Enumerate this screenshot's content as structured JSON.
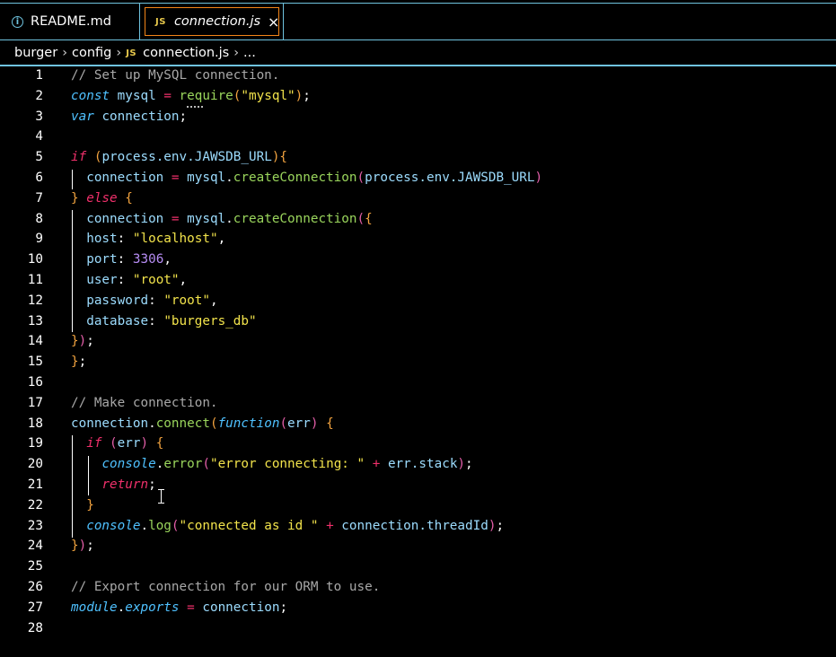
{
  "tabs": [
    {
      "label": "README.md",
      "icon": "info-icon",
      "active": false
    },
    {
      "label": "connection.js",
      "icon": "js-icon",
      "active": true,
      "close": "×"
    }
  ],
  "js_icon_text": "JS",
  "info_icon_text": "i",
  "breadcrumb": {
    "items": [
      "burger",
      "config",
      "connection.js",
      "..."
    ],
    "separator": "›"
  },
  "colors": {
    "accent_border": "#6fc3df",
    "active_tab_border": "#f38518",
    "background": "#000000"
  },
  "lines": [
    {
      "n": "1",
      "tokens": [
        [
          "c-com",
          "// Set up MySQL connection."
        ]
      ]
    },
    {
      "n": "2",
      "tokens": [
        [
          "c-kw",
          "const"
        ],
        [
          "c-pun",
          " "
        ],
        [
          "c-var",
          "mysql"
        ],
        [
          "c-pun",
          " "
        ],
        [
          "c-op",
          "="
        ],
        [
          "c-pun",
          " "
        ],
        [
          "c-fn",
          "require"
        ],
        [
          "c-p1",
          "("
        ],
        [
          "c-str",
          "\"mysql\""
        ],
        [
          "c-p1",
          ")"
        ],
        [
          "c-pun",
          ";"
        ]
      ]
    },
    {
      "n": "3",
      "tokens": [
        [
          "c-kw",
          "var"
        ],
        [
          "c-pun",
          " "
        ],
        [
          "c-var",
          "connection"
        ],
        [
          "c-pun",
          ";"
        ]
      ]
    },
    {
      "n": "4",
      "tokens": []
    },
    {
      "n": "5",
      "tokens": [
        [
          "c-ctl",
          "if"
        ],
        [
          "c-pun",
          " "
        ],
        [
          "c-p1",
          "("
        ],
        [
          "c-var",
          "process.env.JAWSDB_URL"
        ],
        [
          "c-p1",
          ")"
        ],
        [
          "c-p1",
          "{"
        ]
      ]
    },
    {
      "n": "6",
      "tokens": [
        [
          "c-pun",
          "  "
        ],
        [
          "c-var",
          "connection"
        ],
        [
          "c-pun",
          " "
        ],
        [
          "c-op",
          "="
        ],
        [
          "c-pun",
          " "
        ],
        [
          "c-var",
          "mysql"
        ],
        [
          "c-pun",
          "."
        ],
        [
          "c-fn",
          "createConnection"
        ],
        [
          "c-p2",
          "("
        ],
        [
          "c-var",
          "process.env.JAWSDB_URL"
        ],
        [
          "c-p2",
          ")"
        ]
      ]
    },
    {
      "n": "7",
      "tokens": [
        [
          "c-p1",
          "}"
        ],
        [
          "c-pun",
          " "
        ],
        [
          "c-ctl",
          "else"
        ],
        [
          "c-pun",
          " "
        ],
        [
          "c-p1",
          "{"
        ]
      ]
    },
    {
      "n": "8",
      "tokens": [
        [
          "c-pun",
          "  "
        ],
        [
          "c-var",
          "connection"
        ],
        [
          "c-pun",
          " "
        ],
        [
          "c-op",
          "="
        ],
        [
          "c-pun",
          " "
        ],
        [
          "c-var",
          "mysql"
        ],
        [
          "c-pun",
          "."
        ],
        [
          "c-fn",
          "createConnection"
        ],
        [
          "c-p2",
          "("
        ],
        [
          "c-p1",
          "{"
        ]
      ]
    },
    {
      "n": "9",
      "tokens": [
        [
          "c-pun",
          "  "
        ],
        [
          "c-var",
          "host"
        ],
        [
          "c-pun",
          ": "
        ],
        [
          "c-str",
          "\"localhost\""
        ],
        [
          "c-pun",
          ","
        ]
      ]
    },
    {
      "n": "10",
      "tokens": [
        [
          "c-pun",
          "  "
        ],
        [
          "c-var",
          "port"
        ],
        [
          "c-pun",
          ": "
        ],
        [
          "c-num",
          "3306"
        ],
        [
          "c-pun",
          ","
        ]
      ]
    },
    {
      "n": "11",
      "tokens": [
        [
          "c-pun",
          "  "
        ],
        [
          "c-var",
          "user"
        ],
        [
          "c-pun",
          ": "
        ],
        [
          "c-str",
          "\"root\""
        ],
        [
          "c-pun",
          ","
        ]
      ]
    },
    {
      "n": "12",
      "tokens": [
        [
          "c-pun",
          "  "
        ],
        [
          "c-var",
          "password"
        ],
        [
          "c-pun",
          ": "
        ],
        [
          "c-str",
          "\"root\""
        ],
        [
          "c-pun",
          ","
        ]
      ]
    },
    {
      "n": "13",
      "tokens": [
        [
          "c-pun",
          "  "
        ],
        [
          "c-var",
          "database"
        ],
        [
          "c-pun",
          ": "
        ],
        [
          "c-str",
          "\"burgers_db\""
        ]
      ]
    },
    {
      "n": "14",
      "tokens": [
        [
          "c-p1",
          "}"
        ],
        [
          "c-p2",
          ")"
        ],
        [
          "c-pun",
          ";"
        ]
      ]
    },
    {
      "n": "15",
      "tokens": [
        [
          "c-p1",
          "}"
        ],
        [
          "c-pun",
          ";"
        ]
      ]
    },
    {
      "n": "16",
      "tokens": []
    },
    {
      "n": "17",
      "tokens": [
        [
          "c-com",
          "// Make connection."
        ]
      ]
    },
    {
      "n": "18",
      "tokens": [
        [
          "c-var",
          "connection"
        ],
        [
          "c-pun",
          "."
        ],
        [
          "c-fn",
          "connect"
        ],
        [
          "c-p1",
          "("
        ],
        [
          "c-kw",
          "function"
        ],
        [
          "c-p2",
          "("
        ],
        [
          "c-var",
          "err"
        ],
        [
          "c-p2",
          ")"
        ],
        [
          "c-pun",
          " "
        ],
        [
          "c-p1",
          "{"
        ]
      ]
    },
    {
      "n": "19",
      "tokens": [
        [
          "c-pun",
          "  "
        ],
        [
          "c-ctl",
          "if"
        ],
        [
          "c-pun",
          " "
        ],
        [
          "c-p2",
          "("
        ],
        [
          "c-var",
          "err"
        ],
        [
          "c-p2",
          ")"
        ],
        [
          "c-pun",
          " "
        ],
        [
          "c-p1",
          "{"
        ]
      ]
    },
    {
      "n": "20",
      "tokens": [
        [
          "c-pun",
          "    "
        ],
        [
          "c-obj",
          "console"
        ],
        [
          "c-pun",
          "."
        ],
        [
          "c-fn",
          "error"
        ],
        [
          "c-p2",
          "("
        ],
        [
          "c-str",
          "\"error connecting: \""
        ],
        [
          "c-pun",
          " "
        ],
        [
          "c-op",
          "+"
        ],
        [
          "c-pun",
          " "
        ],
        [
          "c-var",
          "err.stack"
        ],
        [
          "c-p2",
          ")"
        ],
        [
          "c-pun",
          ";"
        ]
      ]
    },
    {
      "n": "21",
      "tokens": [
        [
          "c-pun",
          "    "
        ],
        [
          "c-ctl",
          "return"
        ],
        [
          "c-pun",
          ";"
        ]
      ]
    },
    {
      "n": "22",
      "tokens": [
        [
          "c-pun",
          "  "
        ],
        [
          "c-p1",
          "}"
        ]
      ]
    },
    {
      "n": "23",
      "tokens": [
        [
          "c-pun",
          "  "
        ],
        [
          "c-obj",
          "console"
        ],
        [
          "c-pun",
          "."
        ],
        [
          "c-fn",
          "log"
        ],
        [
          "c-p2",
          "("
        ],
        [
          "c-str",
          "\"connected as id \""
        ],
        [
          "c-pun",
          " "
        ],
        [
          "c-op",
          "+"
        ],
        [
          "c-pun",
          " "
        ],
        [
          "c-var",
          "connection.threadId"
        ],
        [
          "c-p2",
          ")"
        ],
        [
          "c-pun",
          ";"
        ]
      ]
    },
    {
      "n": "24",
      "tokens": [
        [
          "c-p1",
          "}"
        ],
        [
          "c-p2",
          ")"
        ],
        [
          "c-pun",
          ";"
        ]
      ]
    },
    {
      "n": "25",
      "tokens": []
    },
    {
      "n": "26",
      "tokens": [
        [
          "c-com",
          "// Export connection for our ORM to use."
        ]
      ]
    },
    {
      "n": "27",
      "tokens": [
        [
          "c-obj",
          "module"
        ],
        [
          "c-pun",
          "."
        ],
        [
          "c-obj",
          "exports"
        ],
        [
          "c-pun",
          " "
        ],
        [
          "c-op",
          "="
        ],
        [
          "c-pun",
          " "
        ],
        [
          "c-var",
          "connection"
        ],
        [
          "c-pun",
          ";"
        ]
      ]
    },
    {
      "n": "28",
      "tokens": []
    }
  ]
}
